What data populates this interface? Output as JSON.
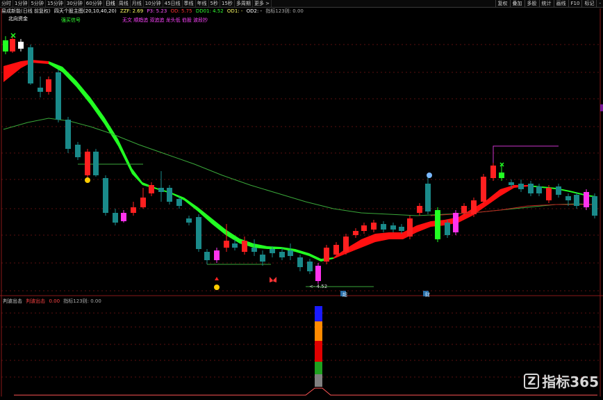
{
  "toolbar": {
    "periods": [
      "分时",
      "1分钟",
      "5分钟",
      "15分钟",
      "30分钟",
      "60分钟",
      "日线",
      "周线",
      "月线",
      "10分钟",
      "45日线",
      "季线",
      "年线",
      "5秒",
      "15秒",
      "多周期",
      "更多 >"
    ],
    "right_buttons": [
      "复权",
      "叠加",
      "多股",
      "统计",
      "画线",
      "F10",
      "标记",
      "-"
    ]
  },
  "info": {
    "stock": "易成新能(日线 前复权)",
    "indicator": "四天个股主图(20,10,40,20)",
    "zzf": "ZZF: 2.69",
    "p3": "P3: 5.23",
    "od": "OD: 5.75",
    "dd01": "DD01: 4.52",
    "od1": "OD1: -",
    "od2": "OD2: -",
    "zb": "指标123则: 0.00"
  },
  "labels": {
    "bei_liang": "北向资金",
    "chao_mai": "强买信号",
    "hot": "无文 顺趋追 双追追 龙头低 伯股 波段抄",
    "bottom_price": "4.52",
    "tag1": "超",
    "tag2": "财"
  },
  "lower": {
    "name": "判波出击",
    "name2": "判波出击",
    "v1": "0.00",
    "v2": "指标123则: 0.00",
    "stack_colors": [
      "#1a1aff",
      "#ff8a00",
      "#e00000",
      "#1fa01f",
      "#808080"
    ]
  },
  "watermark": {
    "logo": "Z",
    "text": "指标365"
  },
  "colors": {
    "up": "#ff2020",
    "down": "#1a8a8a",
    "band_up": "#ff1010",
    "band_down": "#22ff22",
    "ma": "#3aa83a",
    "bg": "#000000"
  }
}
